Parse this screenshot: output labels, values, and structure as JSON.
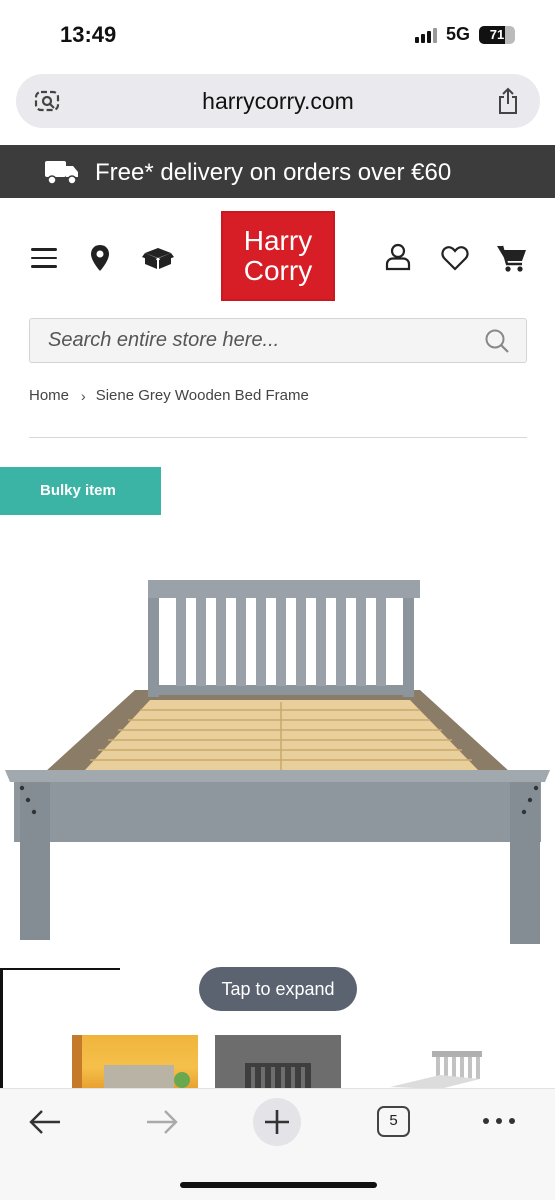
{
  "status_bar": {
    "time": "13:49",
    "network": "5G",
    "battery_level": "71",
    "battery_fraction": 0.71
  },
  "browser": {
    "url": "harrycorry.com",
    "left_icon": "page-settings-icon",
    "right_icon": "share-icon"
  },
  "promo": {
    "icon": "delivery-truck-icon",
    "text": "Free* delivery on orders over €60"
  },
  "header": {
    "logo_line1": "Harry",
    "logo_line2": "Corry",
    "logo_color": "#d71e26",
    "icons": [
      "menu-icon",
      "location-icon",
      "box-icon",
      "account-icon",
      "heart-icon",
      "cart-icon"
    ]
  },
  "search": {
    "placeholder": "Search entire store here...",
    "value": ""
  },
  "breadcrumb": {
    "home": "Home",
    "separator": "›",
    "current": "Siene Grey Wooden Bed Frame"
  },
  "product": {
    "badge": "Bulky item",
    "badge_color": "#3bb3a5",
    "tap_to_expand": "Tap to expand"
  },
  "toolbar": {
    "tab_count": "5",
    "icons": [
      "back-arrow-icon",
      "forward-arrow-icon",
      "new-tab-icon",
      "tabs-icon",
      "more-icon"
    ]
  }
}
